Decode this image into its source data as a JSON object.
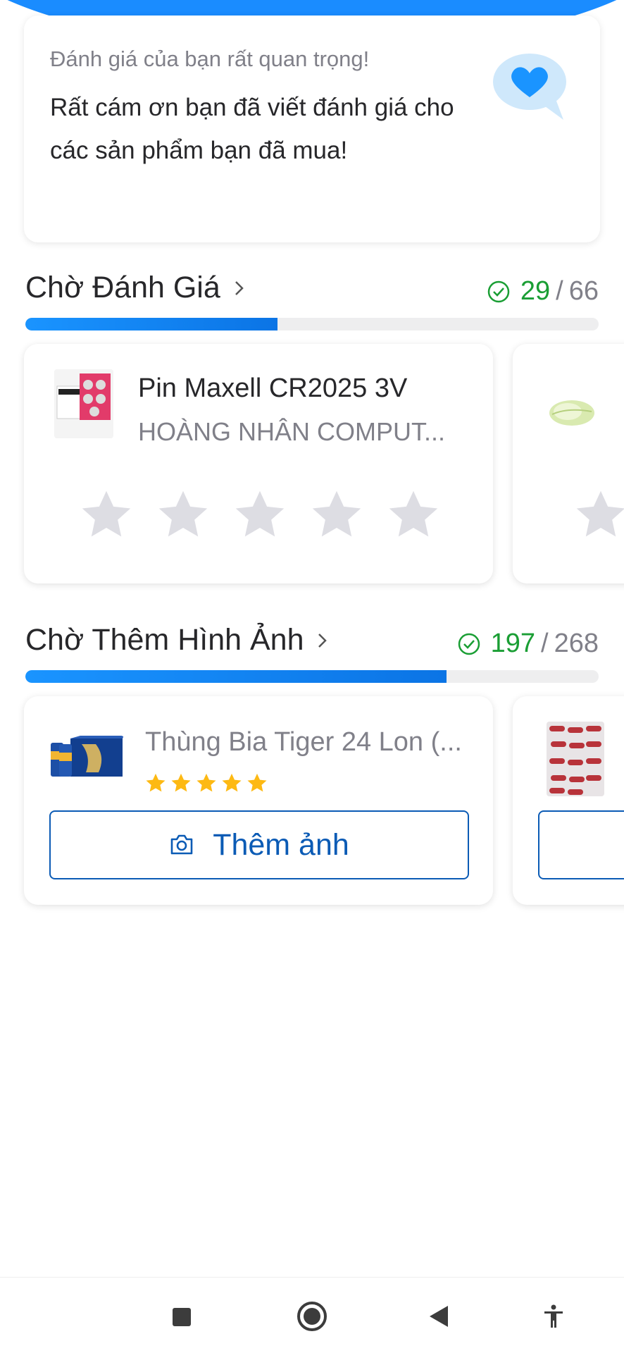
{
  "greeting": {
    "subtitle": "Đánh giá của bạn rất quan trọng!",
    "message": "Rất cám ơn bạn đã viết đánh giá cho các sản phẩm bạn đã mua!",
    "icon": "heart-bubble-icon"
  },
  "pending_reviews": {
    "title": "Chờ Đánh Giá",
    "done": "29",
    "separator": "/",
    "total": "66",
    "progress_fraction": 0.44,
    "items": [
      {
        "name": "Pin Maxell CR2025 3V",
        "seller": "HOÀNG NHÂN COMPUT...",
        "rating": 0
      }
    ]
  },
  "pending_photos": {
    "title": "Chờ Thêm Hình Ảnh",
    "done": "197",
    "separator": "/",
    "total": "268",
    "progress_fraction": 0.735,
    "items": [
      {
        "name": "Thùng Bia Tiger 24 Lon (...",
        "rating": 5,
        "button_label": "Thêm ảnh"
      }
    ]
  },
  "colors": {
    "accent": "#1a94ff",
    "button": "#0b5bb5",
    "success": "#1a9e34",
    "star_empty": "#dddde3",
    "star_filled": "#fdd835"
  },
  "navbar": {
    "icons": [
      "recent-apps-icon",
      "home-icon",
      "back-icon",
      "accessibility-icon"
    ]
  }
}
